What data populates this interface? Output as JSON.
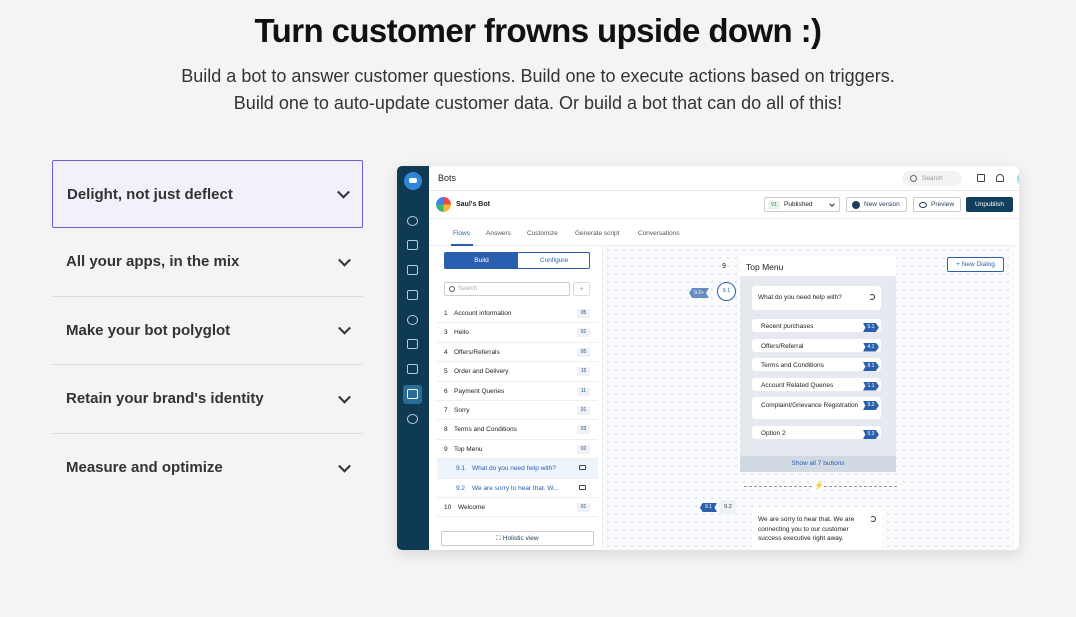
{
  "hero": {
    "title": "Turn customer frowns upside down :)",
    "subtitle_line1": "Build a bot to answer customer questions. Build one to execute actions based on triggers.",
    "subtitle_line2": "Build one to auto-update customer data. Or build a bot that can do all of this!"
  },
  "accordion": {
    "items": [
      {
        "label": "Delight, not just deflect",
        "active": true
      },
      {
        "label": "All your apps, in the mix"
      },
      {
        "label": "Make your bot polyglot"
      },
      {
        "label": "Retain your brand's identity"
      },
      {
        "label": "Measure and optimize"
      }
    ]
  },
  "app": {
    "title": "Bots",
    "search_placeholder": "Search",
    "avatar_initial": "A",
    "bot_name": "Saul's Bot",
    "version_tag": "V1",
    "status": "Published",
    "new_version": "New version",
    "preview": "Preview",
    "unpublish": "Unpublish",
    "tabs": [
      "Flows",
      "Answers",
      "Customize",
      "Generate script",
      "Conversations"
    ],
    "segment": {
      "build": "Build",
      "configure": "Configure"
    },
    "flow_search_placeholder": "Search",
    "flow_add": "+",
    "flows": [
      {
        "num": "1",
        "label": "Account information",
        "count": "05"
      },
      {
        "num": "3",
        "label": "Hello",
        "count": "01"
      },
      {
        "num": "4",
        "label": "Offers/Referrals",
        "count": "05"
      },
      {
        "num": "5",
        "label": "Order and Delivery",
        "count": "15"
      },
      {
        "num": "6",
        "label": "Payment Queries",
        "count": "11"
      },
      {
        "num": "7",
        "label": "Sorry",
        "count": "01"
      },
      {
        "num": "8",
        "label": "Terms and Conditions",
        "count": "03"
      },
      {
        "num": "9",
        "label": "Top Menu",
        "count": "02"
      },
      {
        "num": "9.1",
        "label": "What do you need help with?",
        "sub": true
      },
      {
        "num": "9.2",
        "label": "We are sorry to hear that. W...",
        "sub": true
      },
      {
        "num": "10",
        "label": "Welcome",
        "count": "01"
      }
    ],
    "holistic_view": "Holistic view",
    "canvas": {
      "new_dialog": "+ New Dialog",
      "dialog_num": "9",
      "dialog_title": "Top Menu",
      "incoming_tag": "9.2+",
      "node_label": "9.1",
      "question": "What do you need help with?",
      "options": [
        {
          "label": "Recent purchases",
          "tag": "5.1"
        },
        {
          "label": "Offers/Referral",
          "tag": "4.1"
        },
        {
          "label": "Terms and Conditions",
          "tag": "8.1"
        },
        {
          "label": "Account Related Queries",
          "tag": "1.1"
        },
        {
          "label": "Complaint/Grievance Registration",
          "tag": "9.2"
        },
        {
          "label": "Option 2",
          "tag": "5.3"
        }
      ],
      "show_all": "Show all 7 buttons",
      "bolt": "⚡",
      "incoming_tag2": "9.1",
      "node2_label": "9.2",
      "message2": "We are sorry to hear that. We are connecting you to our customer success executive right away."
    }
  }
}
